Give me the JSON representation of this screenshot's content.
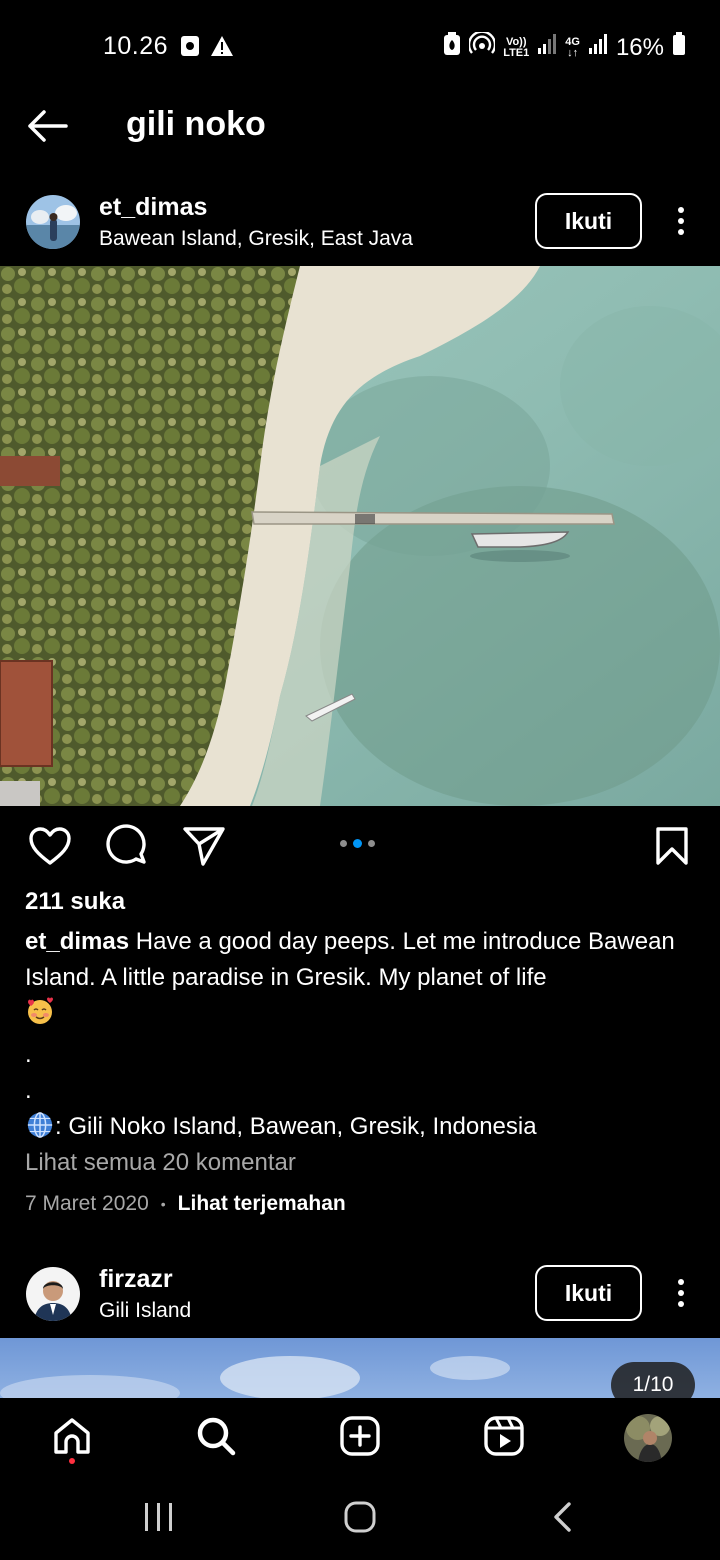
{
  "status_bar": {
    "time": "10.26",
    "battery": "16%",
    "volte_top": "Vo))",
    "volte_bottom": "LTE1",
    "net_top": "4G",
    "net_bottom": "↓↑",
    "icons": [
      "screenshot-icon",
      "warning-icon",
      "battery-saver-icon",
      "hotspot-icon",
      "signal-icon",
      "signal-icon",
      "battery-icon"
    ]
  },
  "header": {
    "title": "gili noko"
  },
  "posts": [
    {
      "username": "et_dimas",
      "location": "Bawean Island, Gresik, East Java",
      "follow_label": "Ikuti",
      "likes": "211 suka",
      "caption_user": "et_dimas",
      "caption_text": "Have a good day peeps. Let me introduce Bawean Island. A little paradise in Gresik. My planet of life",
      "caption_emoji": "🥰",
      "caption_dots": [
        ".",
        "."
      ],
      "caption_location_emoji": "🌐",
      "caption_location": ": Gili Noko Island, Bawean, Gresik, Indonesia",
      "view_comments": "Lihat semua 20 komentar",
      "date": "7 Maret 2020",
      "separator": "•",
      "translate": "Lihat terjemahan",
      "carousel": {
        "pages": 3,
        "active": 2
      }
    },
    {
      "username": "firzazr",
      "location": "Gili Island",
      "follow_label": "Ikuti",
      "counter": "1/10"
    }
  ],
  "bottom_nav": {
    "items": [
      "home-icon",
      "search-icon",
      "create-icon",
      "reels-icon",
      "profile-avatar"
    ],
    "active": "search-icon"
  },
  "system_nav": [
    "recents-icon",
    "home-circle-icon",
    "back-icon"
  ],
  "colors": {
    "background": "#000000",
    "text": "#ffffff",
    "muted": "#a8a8a8",
    "accent": "#0095f6",
    "notify": "#ff3040"
  }
}
